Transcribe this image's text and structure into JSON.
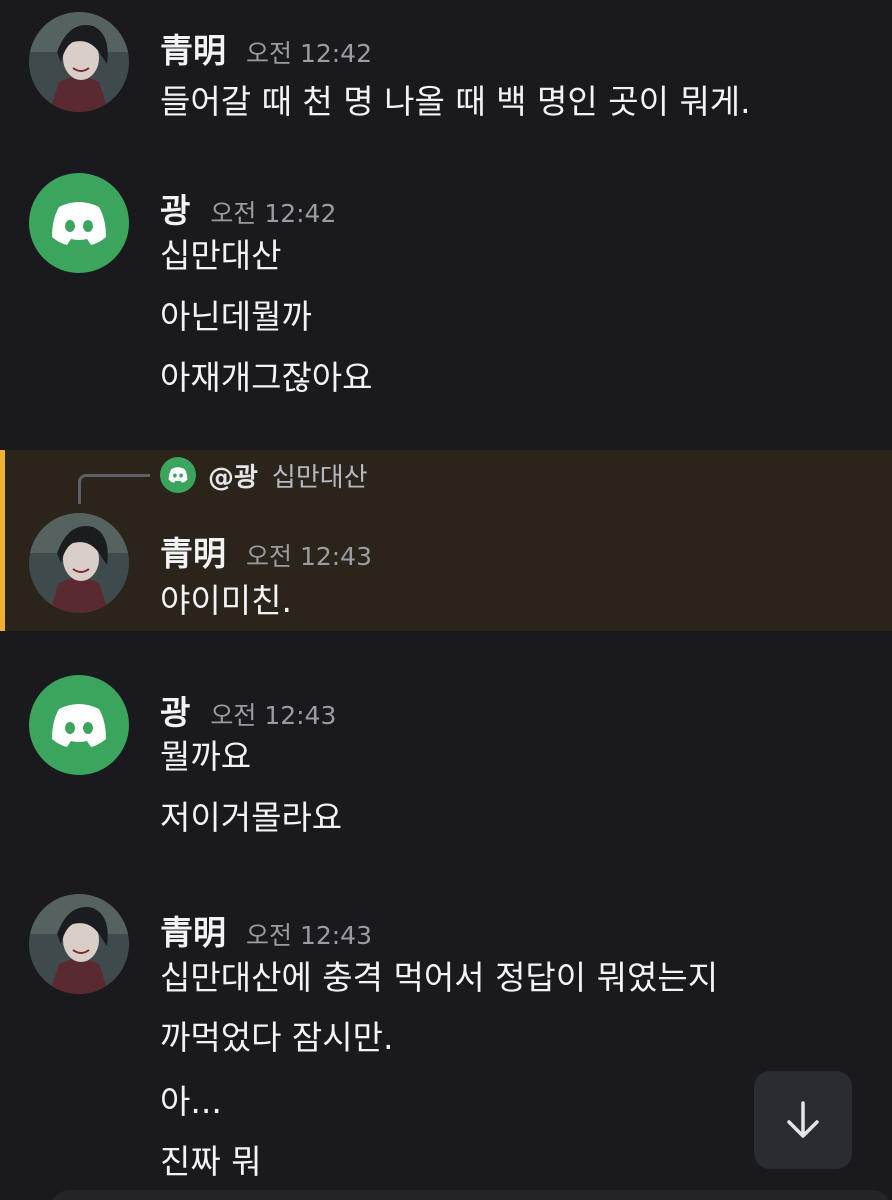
{
  "colors": {
    "background": "#1a1a1e",
    "highlight_background": "#2b241b",
    "highlight_bar": "#f0b132",
    "discord_green": "#3ba55d",
    "timestamp": "#9a9ca3"
  },
  "messages": [
    {
      "author": "青明",
      "timestamp": "오전 12:42",
      "avatar": "anime-character-avatar",
      "lines": [
        "들어갈 때 천 명 나올 때 백 명인 곳이 뭐게."
      ]
    },
    {
      "author": "광",
      "timestamp": "오전 12:42",
      "avatar": "discord-logo-icon",
      "lines": [
        "십만대산",
        "아닌데뭘까",
        "아재개그잖아요"
      ]
    },
    {
      "author": "青明",
      "timestamp": "오전 12:43",
      "avatar": "anime-character-avatar",
      "reply": {
        "mention": "@광",
        "preview": "십만대산"
      },
      "lines": [
        "야이미친."
      ]
    },
    {
      "author": "광",
      "timestamp": "오전 12:43",
      "avatar": "discord-logo-icon",
      "lines": [
        "뭘까요",
        "저이거몰라요"
      ]
    },
    {
      "author": "青明",
      "timestamp": "오전 12:43",
      "avatar": "anime-character-avatar",
      "lines": [
        "십만대산에 충격 먹어서 정답이 뭐였는지",
        "까먹었다 잠시만.",
        "아...",
        "진짜 뭐"
      ]
    }
  ],
  "scroll_button": {
    "icon": "arrow-down-icon"
  }
}
